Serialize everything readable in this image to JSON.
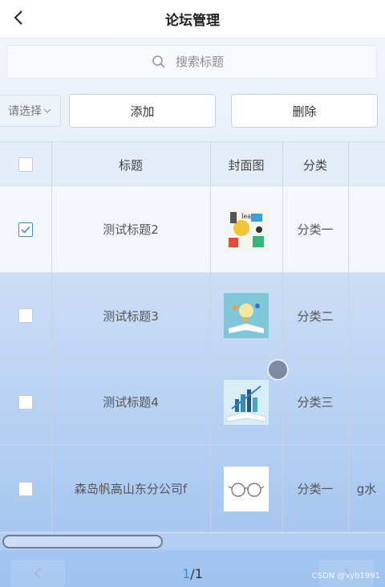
{
  "header": {
    "title": "论坛管理",
    "back_icon": "chevron-left-icon"
  },
  "search": {
    "placeholder": "搜索标题",
    "icon": "search-icon"
  },
  "toolbar": {
    "select_label": "请选择",
    "add_label": "添加",
    "delete_label": "删除"
  },
  "table": {
    "columns": [
      "标题",
      "封面图",
      "分类"
    ],
    "rows": [
      {
        "checked": true,
        "title": "测试标题2",
        "cover": "illustration",
        "category": "分类一",
        "extra": ""
      },
      {
        "checked": false,
        "title": "测试标题3",
        "cover": "book-bulb",
        "category": "分类二",
        "extra": ""
      },
      {
        "checked": false,
        "title": "测试标题4",
        "cover": "book-city",
        "category": "分类三",
        "extra": ""
      },
      {
        "checked": false,
        "title": "森岛帆高山东分公司f",
        "cover": "glasses",
        "category": "分类一",
        "extra": "g水"
      }
    ]
  },
  "pagination": {
    "current": "1",
    "total": "/1"
  },
  "watermark": "CSDN @xyb1991",
  "colors": {
    "accent": "#3a8be8"
  }
}
